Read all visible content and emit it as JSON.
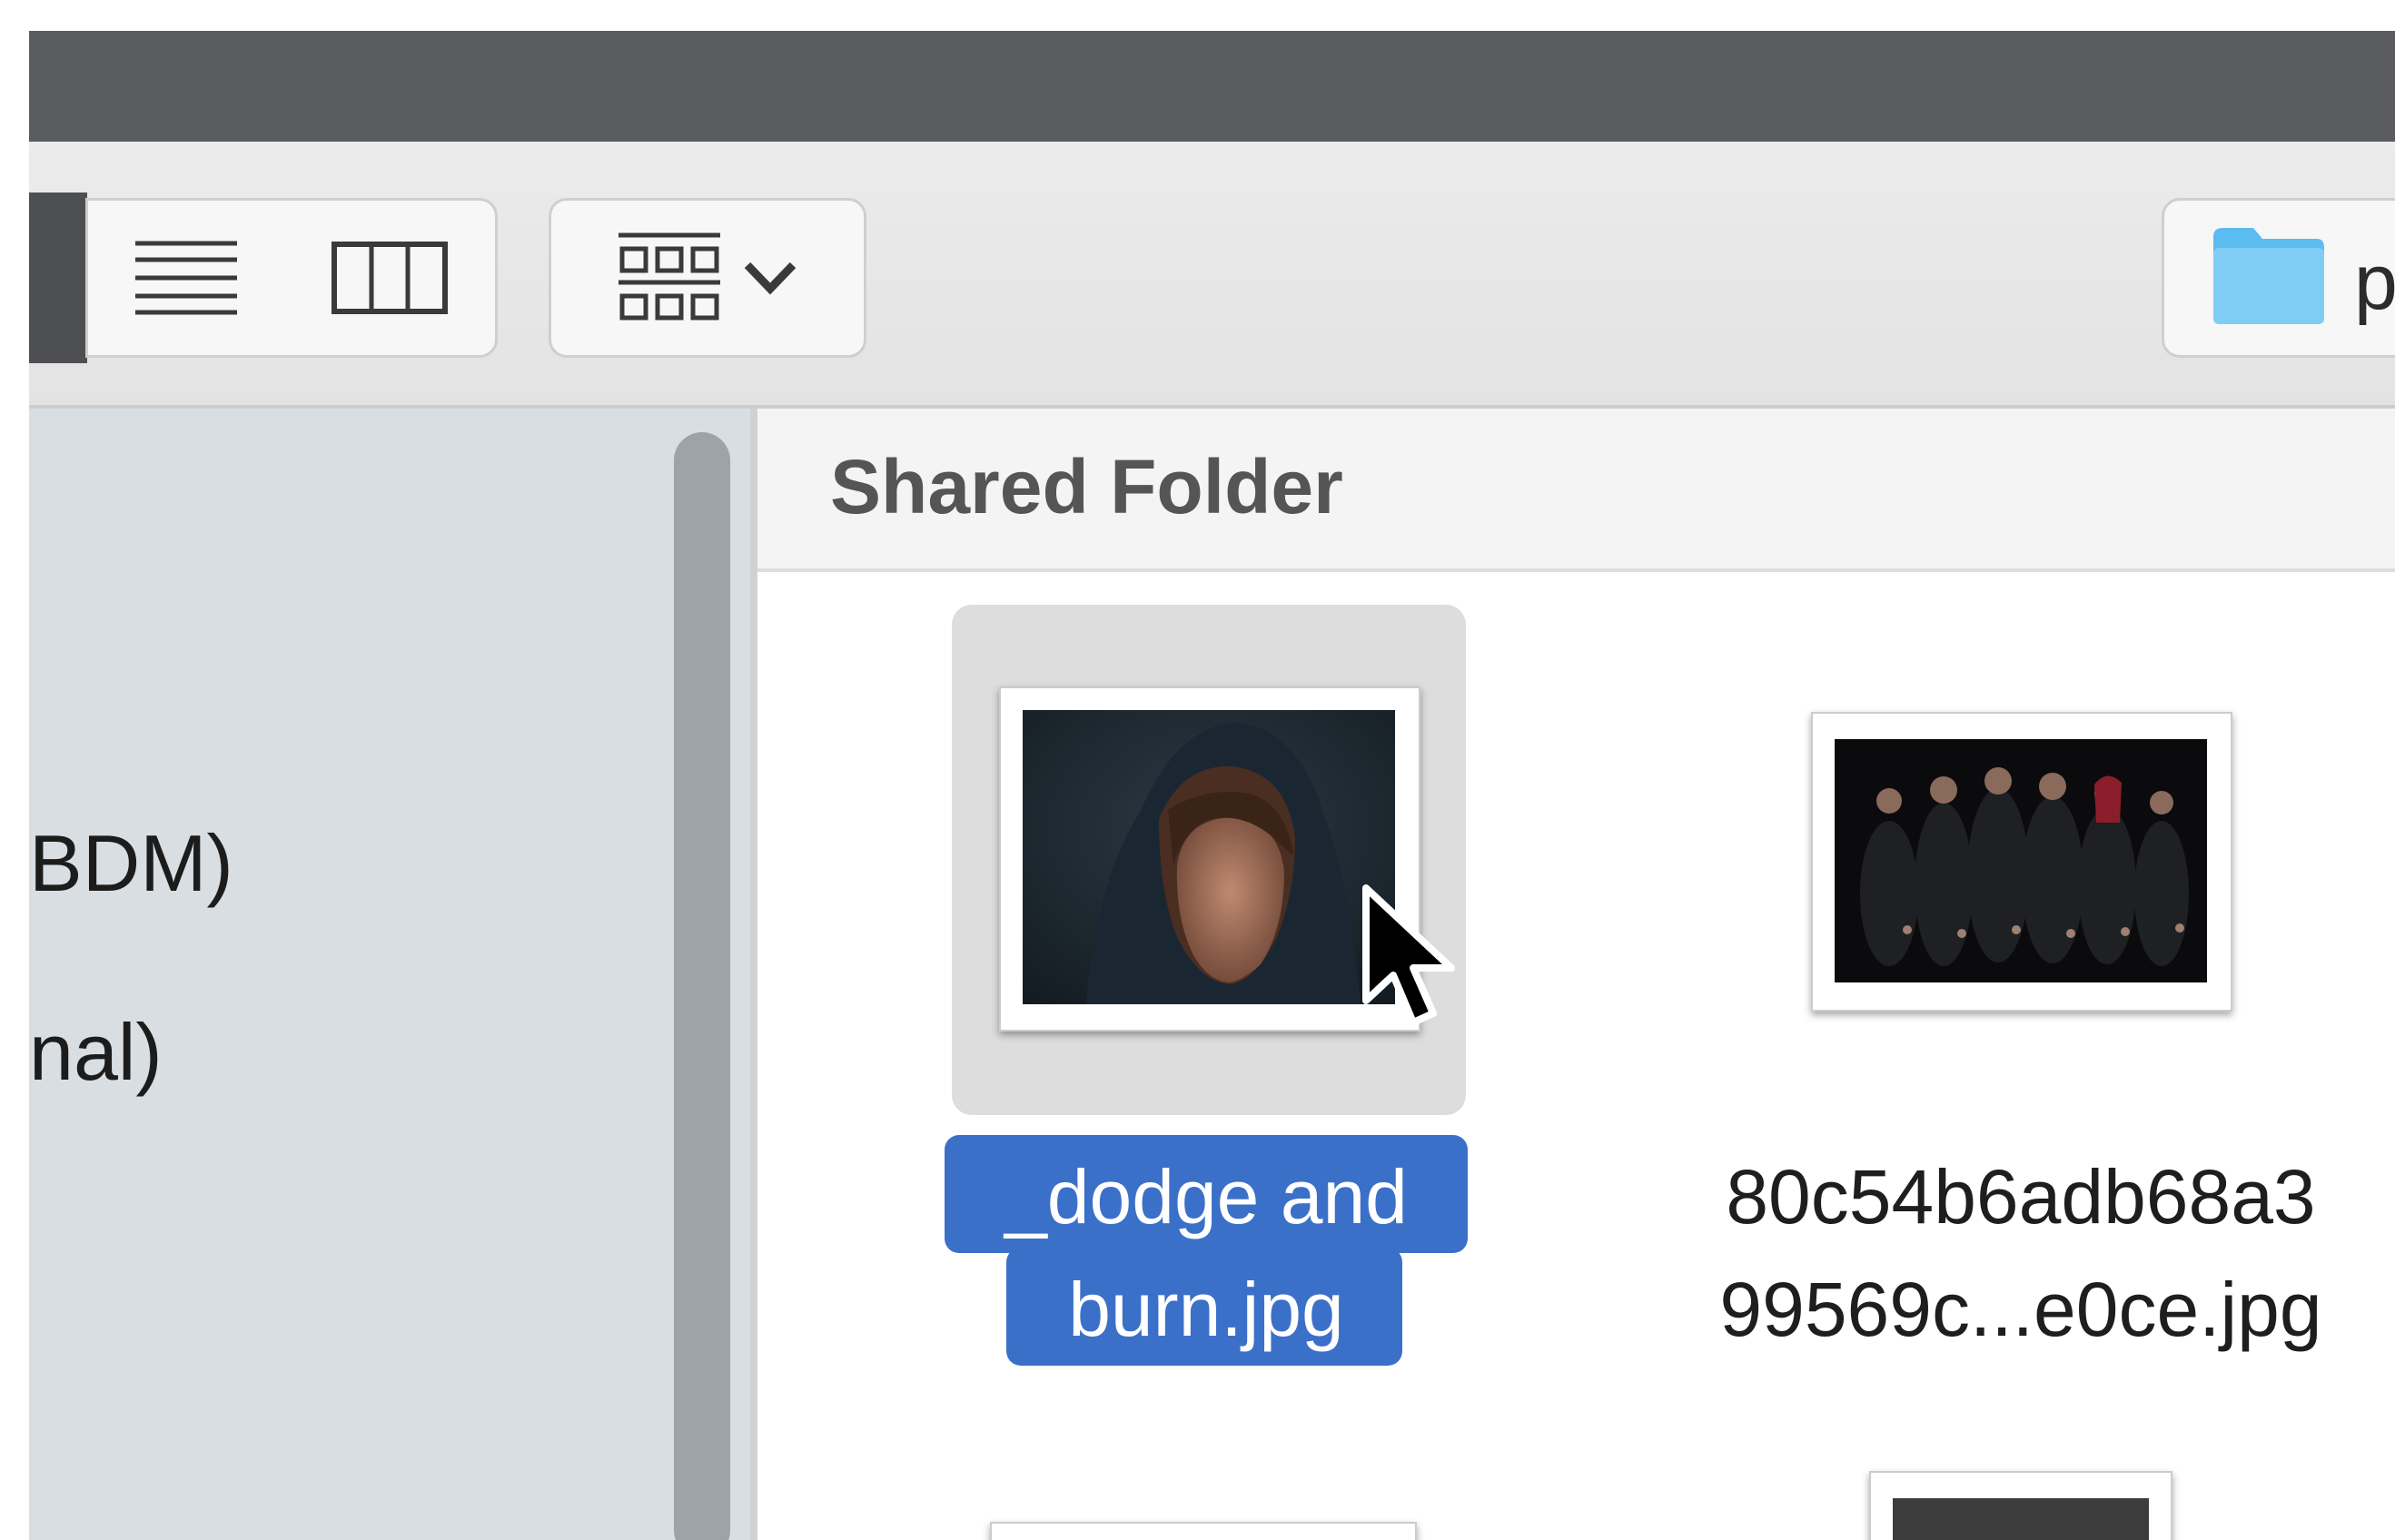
{
  "toolbar": {
    "view_buttons": [
      {
        "icon": "list-view-icon"
      },
      {
        "icon": "column-view-icon"
      }
    ],
    "arrange_button": {
      "icon": "group-view-icon",
      "chevron": "chevron-down-icon"
    },
    "path_button": {
      "icon": "folder-icon",
      "label": "p"
    }
  },
  "sidebar": {
    "items": [
      {
        "label": "BDM)"
      },
      {
        "label": "nal)"
      }
    ]
  },
  "content": {
    "section_title": "Shared Folder",
    "files": [
      {
        "name_line1": "_dodge and",
        "name_line2": "burn.jpg",
        "selected": true
      },
      {
        "name_line1": "80c54b6adb68a3",
        "name_line2": "99569c...e0ce.jpg",
        "selected": false
      }
    ]
  },
  "colors": {
    "title_bar": "#5a5c5f",
    "sidebar_bg": "#d8dee1",
    "selection_blue": "#3b70c9",
    "folder_blue": "#5bbcef"
  }
}
